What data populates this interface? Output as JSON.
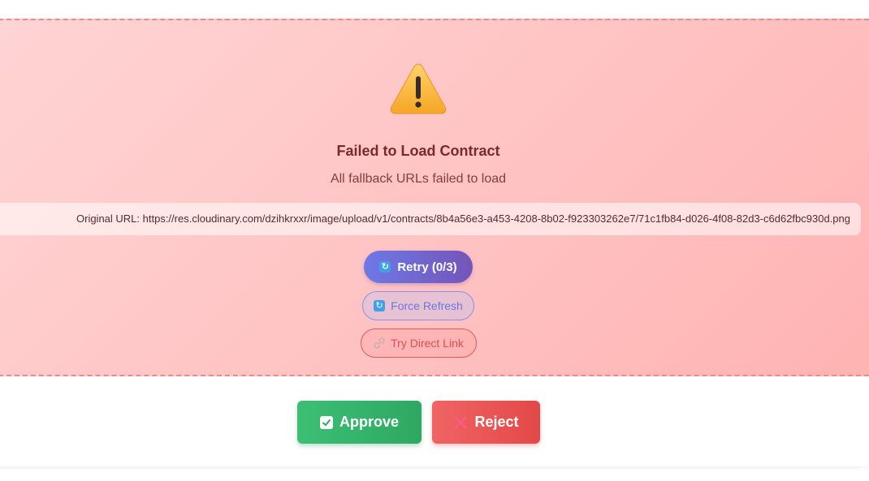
{
  "error": {
    "title": "Failed to Load Contract",
    "message": "All fallback URLs failed to load",
    "original_url": "Original URL: https://res.cloudinary.com/dzihkrxxr/image/upload/v1/contracts/8b4a56e3-a453-4208-8b02-f923303262e7/71c1fb84-d026-4f08-82d3-c6d62fbc930d.png"
  },
  "actions": {
    "retry_label": "Retry (0/3)",
    "force_refresh_label": "Force Refresh",
    "direct_link_label": "Try Direct Link"
  },
  "review": {
    "approve_label": "Approve",
    "reject_label": "Reject"
  },
  "icons": {
    "warning": "warning-icon",
    "refresh": "refresh-icon",
    "link": "link-icon",
    "check": "check-icon",
    "cross": "cross-icon"
  },
  "colors": {
    "error_bg": "#ffc4c4",
    "retry": "#7066d0",
    "approve": "#34b46c",
    "reject": "#ea5656"
  }
}
